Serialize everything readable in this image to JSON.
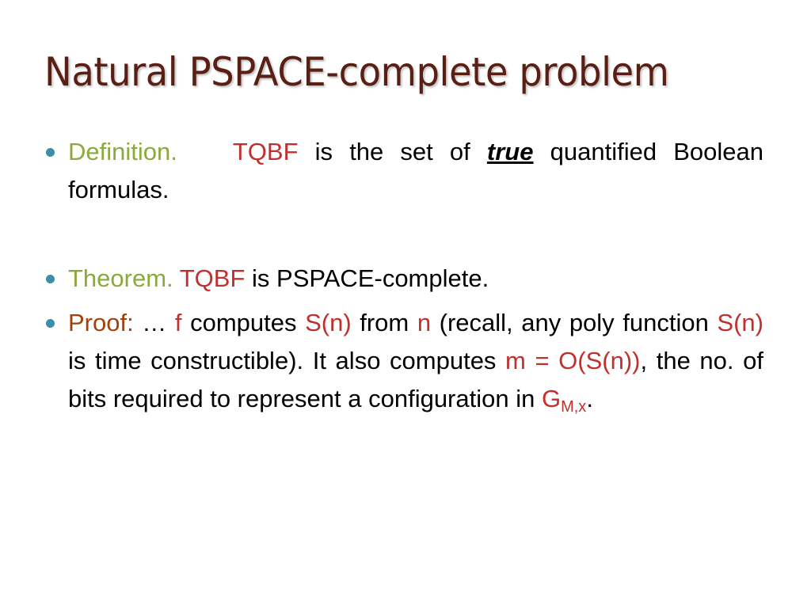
{
  "slide": {
    "title": "Natural PSPACE-complete problem",
    "colors": {
      "title": "#5a1f14",
      "label_definition": "#8aaa3c",
      "label_theorem": "#8aaa3c",
      "label_proof": "#a0420c",
      "highlight": "#c0312d",
      "bullet": "#3b8ea5"
    },
    "definition": {
      "label": "Definition.",
      "term": "TQBF",
      "text1": " is the set of ",
      "emph": "true",
      "text2": " quantified Boolean formulas."
    },
    "theorem": {
      "label": "Theorem.",
      "term": "TQBF",
      "text": " is PSPACE-complete."
    },
    "proof": {
      "label": "Proof:",
      "t1": "  … ",
      "f": "f",
      "t2": " computes ",
      "sn1": "S(n)",
      "t3": " from ",
      "n": "n",
      "t4": " (recall, any poly function ",
      "sn2": "S(n)",
      "t5": " is time constructible). It also computes ",
      "m": "m = O(S(n))",
      "t6": ", the no. of bits required to represent a configuration in ",
      "g": "G",
      "g_sub": "M,x",
      "t7": "."
    }
  }
}
